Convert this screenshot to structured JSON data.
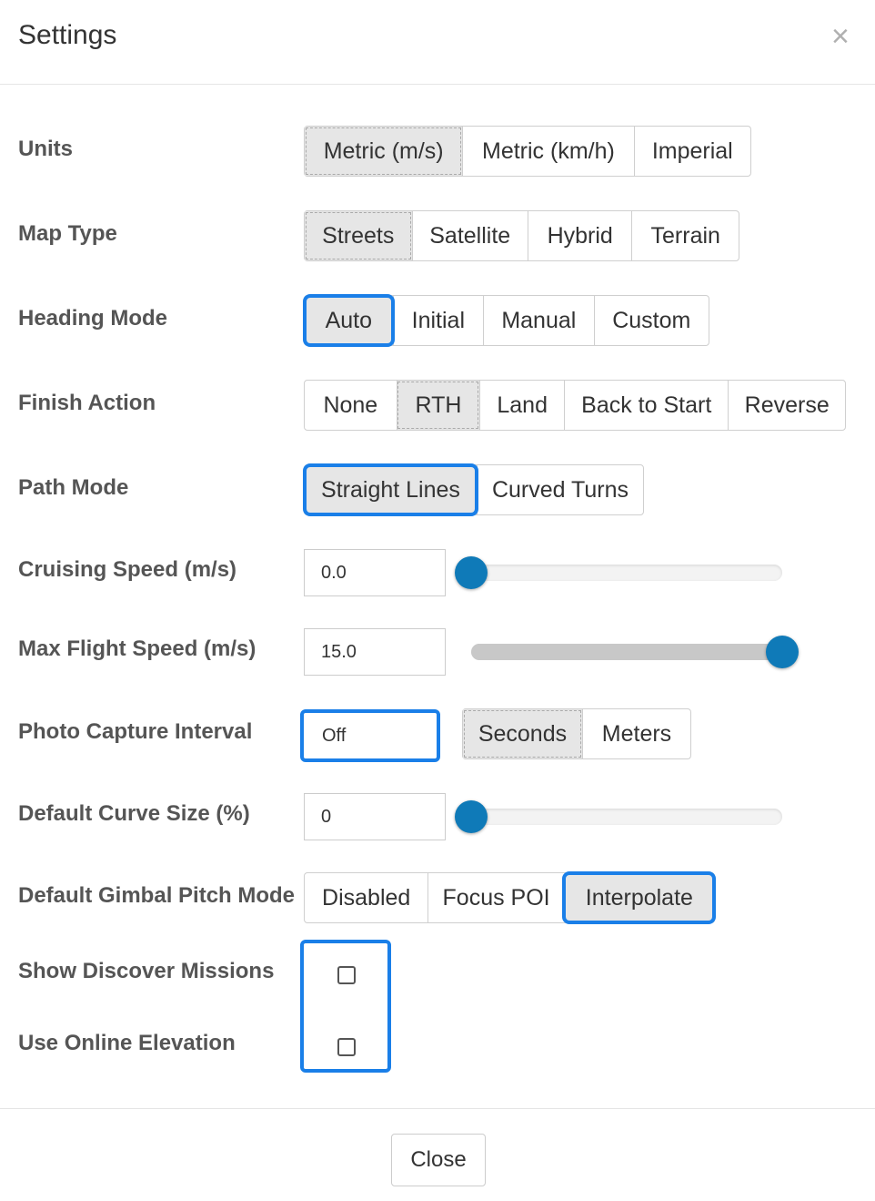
{
  "dialog": {
    "title": "Settings",
    "close_icon": "×",
    "close_button": "Close"
  },
  "rows": {
    "units": {
      "label": "Units",
      "options": [
        "Metric (m/s)",
        "Metric (km/h)",
        "Imperial"
      ],
      "selected": "Metric (m/s)"
    },
    "map_type": {
      "label": "Map Type",
      "options": [
        "Streets",
        "Satellite",
        "Hybrid",
        "Terrain"
      ],
      "selected": "Streets"
    },
    "heading_mode": {
      "label": "Heading Mode",
      "options": [
        "Auto",
        "Initial",
        "Manual",
        "Custom"
      ],
      "selected": "Auto"
    },
    "finish_action": {
      "label": "Finish Action",
      "options": [
        "None",
        "RTH",
        "Land",
        "Back to Start",
        "Reverse"
      ],
      "selected": "RTH"
    },
    "path_mode": {
      "label": "Path Mode",
      "options": [
        "Straight Lines",
        "Curved Turns"
      ],
      "selected": "Straight Lines"
    },
    "cruising_speed": {
      "label": "Cruising Speed (m/s)",
      "value": "0.0",
      "slider_fraction": 0.0
    },
    "max_flight_speed": {
      "label": "Max Flight Speed (m/s)",
      "value": "15.0",
      "slider_fraction": 1.0
    },
    "photo_capture": {
      "label": "Photo Capture Interval",
      "value": "Off",
      "options": [
        "Seconds",
        "Meters"
      ],
      "selected": "Seconds"
    },
    "default_curve": {
      "label": "Default Curve Size (%)",
      "value": "0",
      "slider_fraction": 0.0
    },
    "gimbal_pitch": {
      "label": "Default Gimbal Pitch Mode",
      "options": [
        "Disabled",
        "Focus POI",
        "Interpolate"
      ],
      "selected": "Interpolate"
    },
    "show_discover": {
      "label": "Show Discover Missions",
      "checked": false
    },
    "online_elevation": {
      "label": "Use Online Elevation",
      "checked": false
    }
  },
  "colors": {
    "accent": "#1a7fe8",
    "slider_thumb": "#0f7ab8",
    "active_bg": "#e6e6e6"
  }
}
